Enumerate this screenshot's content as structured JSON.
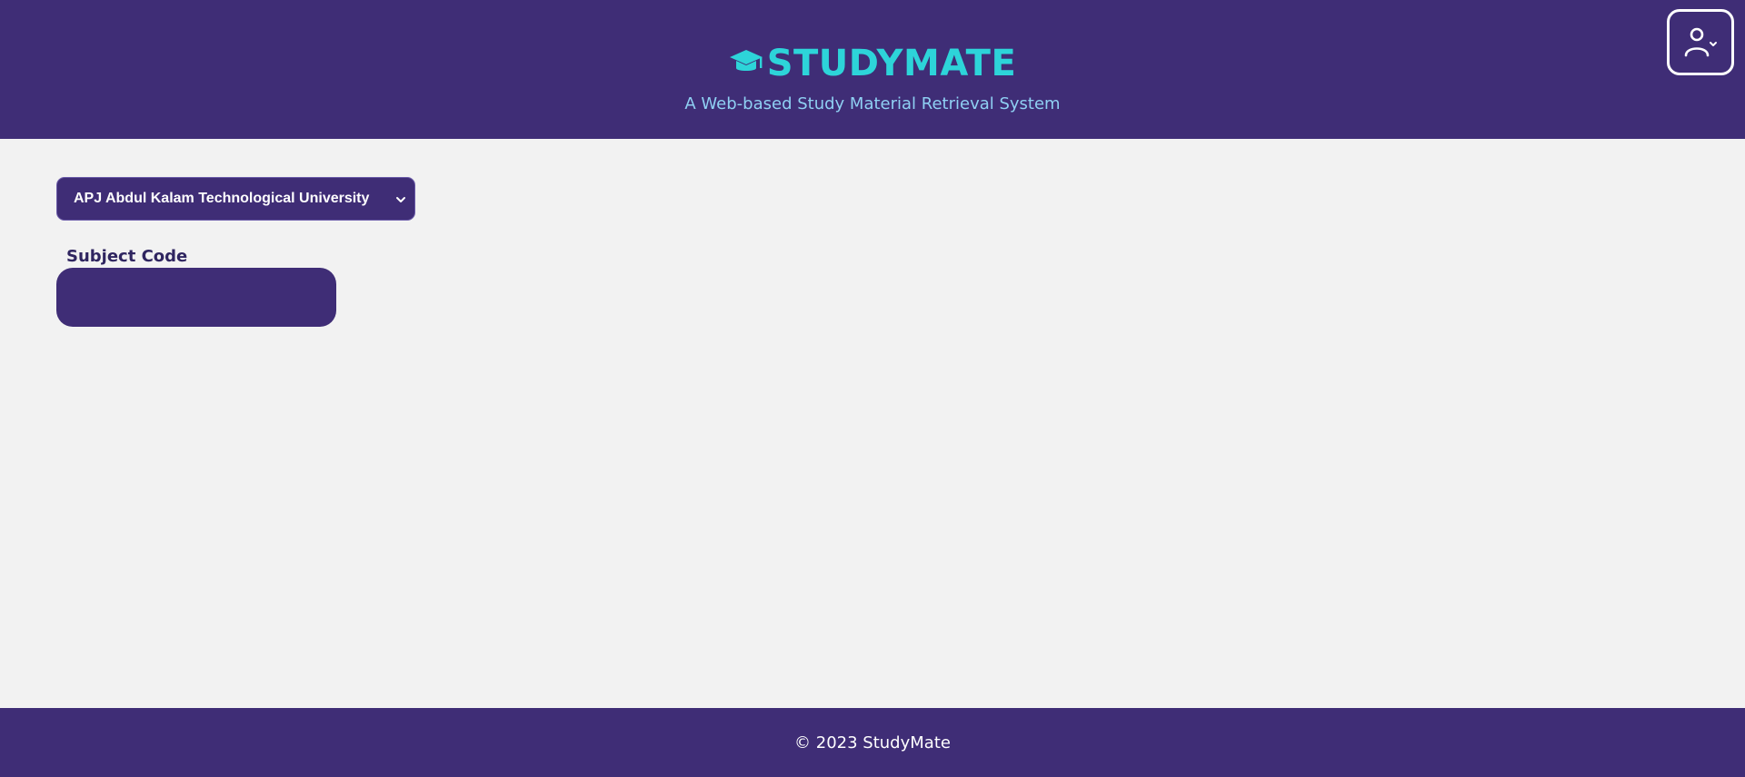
{
  "header": {
    "brand_name": "STUDYMATE",
    "tagline": "A Web-based Study Material Retrieval System",
    "logo_icon": "graduation-cap-icon",
    "profile_icon": "user-icon",
    "profile_chevron_icon": "chevron-down-icon"
  },
  "filters": {
    "university_select": {
      "selected": "APJ Abdul Kalam Technological University",
      "chevron_icon": "chevron-down-icon"
    },
    "subject_code": {
      "label": "Subject Code",
      "value": "",
      "placeholder": ""
    }
  },
  "footer": {
    "text": "© 2023 StudyMate"
  },
  "colors": {
    "primary": "#3f2d76",
    "accent": "#2dd4d9",
    "tagline": "#8fd0f3",
    "background": "#f2f2f2"
  }
}
